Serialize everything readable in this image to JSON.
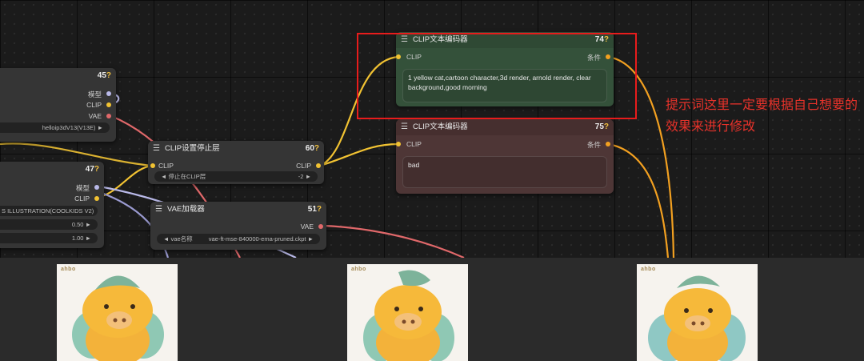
{
  "node_45": {
    "id": "45",
    "outputs": [
      "模型",
      "CLIP",
      "VAE"
    ],
    "ckpt": "helloip3dV13(V13E)"
  },
  "node_47": {
    "id": "47",
    "outputs": [
      "模型",
      "CLIP"
    ],
    "lora": "S ILLUSTRATION(COOLKIDS V2)",
    "strength_model": "0.50",
    "strength_clip": "1.00"
  },
  "clip_stop": {
    "title": "CLIP设置停止层",
    "id": "60",
    "input": "CLIP",
    "output": "CLIP",
    "widget_label": "停止在CLIP层",
    "widget_value": "-2"
  },
  "vae_loader": {
    "title": "VAE加载器",
    "id": "51",
    "output": "VAE",
    "widget_label": "vae名称",
    "widget_value": "vae-ft-mse-840000-ema-pruned.ckpt"
  },
  "clip_pos": {
    "title": "CLIP文本编码器",
    "id": "74",
    "input": "CLIP",
    "output": "条件",
    "text": "1 yellow cat,cartoon character,3d render, arnold render, clear background,good morning"
  },
  "clip_neg": {
    "title": "CLIP文本编码器",
    "id": "75",
    "input": "CLIP",
    "output": "条件",
    "text": "bad"
  },
  "annotation": "提示词这里一定要根据自己想要的效果来进行修改",
  "gallery": [
    {
      "logo": "ahbo"
    },
    {
      "logo": "ahbo"
    },
    {
      "logo": "ahbo"
    }
  ],
  "colors": {
    "clip_wire": "#f1c232",
    "vae_wire": "#e0686a",
    "model_wire": "#b9b9e8",
    "cond_wire": "#f2a020",
    "highlight": "#e81c1c",
    "positive_node": "#34513a",
    "negative_node": "#4e3636"
  }
}
